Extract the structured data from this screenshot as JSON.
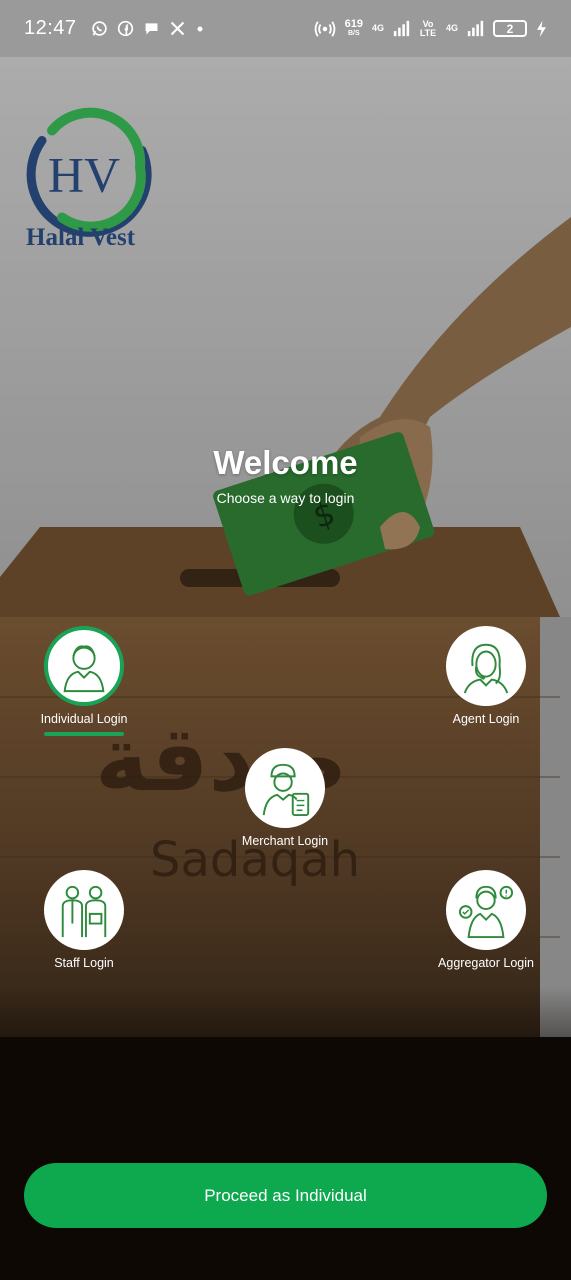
{
  "status_bar": {
    "time": "12:47",
    "net_speed_value": "619",
    "net_speed_unit": "B/S",
    "sim1_label": "4G",
    "volte_label": "Vo LTE",
    "sim2_label": "4G",
    "battery_level": "2",
    "icons": [
      "whatsapp-icon",
      "facebook-icon",
      "chat-icon",
      "x-icon",
      "dot-icon",
      "hotspot-icon",
      "signal-icon",
      "charging-icon"
    ]
  },
  "logo": {
    "monogram": "HV",
    "name": "Halal Vest",
    "colors": {
      "green": "#2e9a48",
      "navy": "#23406e"
    }
  },
  "background_art": {
    "box_text_arabic": "صدقة",
    "box_text_latin": "Sadaqah"
  },
  "welcome": {
    "title": "Welcome",
    "subtitle": "Choose a way to login"
  },
  "login_options": [
    {
      "label": "Individual Login",
      "icon": "individual-icon",
      "selected": true
    },
    {
      "label": "Agent Login",
      "icon": "agent-icon",
      "selected": false
    },
    {
      "label": "Merchant Login",
      "icon": "merchant-icon",
      "selected": false
    },
    {
      "label": "Staff Login",
      "icon": "staff-icon",
      "selected": false
    },
    {
      "label": "Aggregator Login",
      "icon": "aggregator-icon",
      "selected": false
    }
  ],
  "proceed_button": {
    "label": "Proceed as Individual",
    "color": "#0ea84f"
  }
}
